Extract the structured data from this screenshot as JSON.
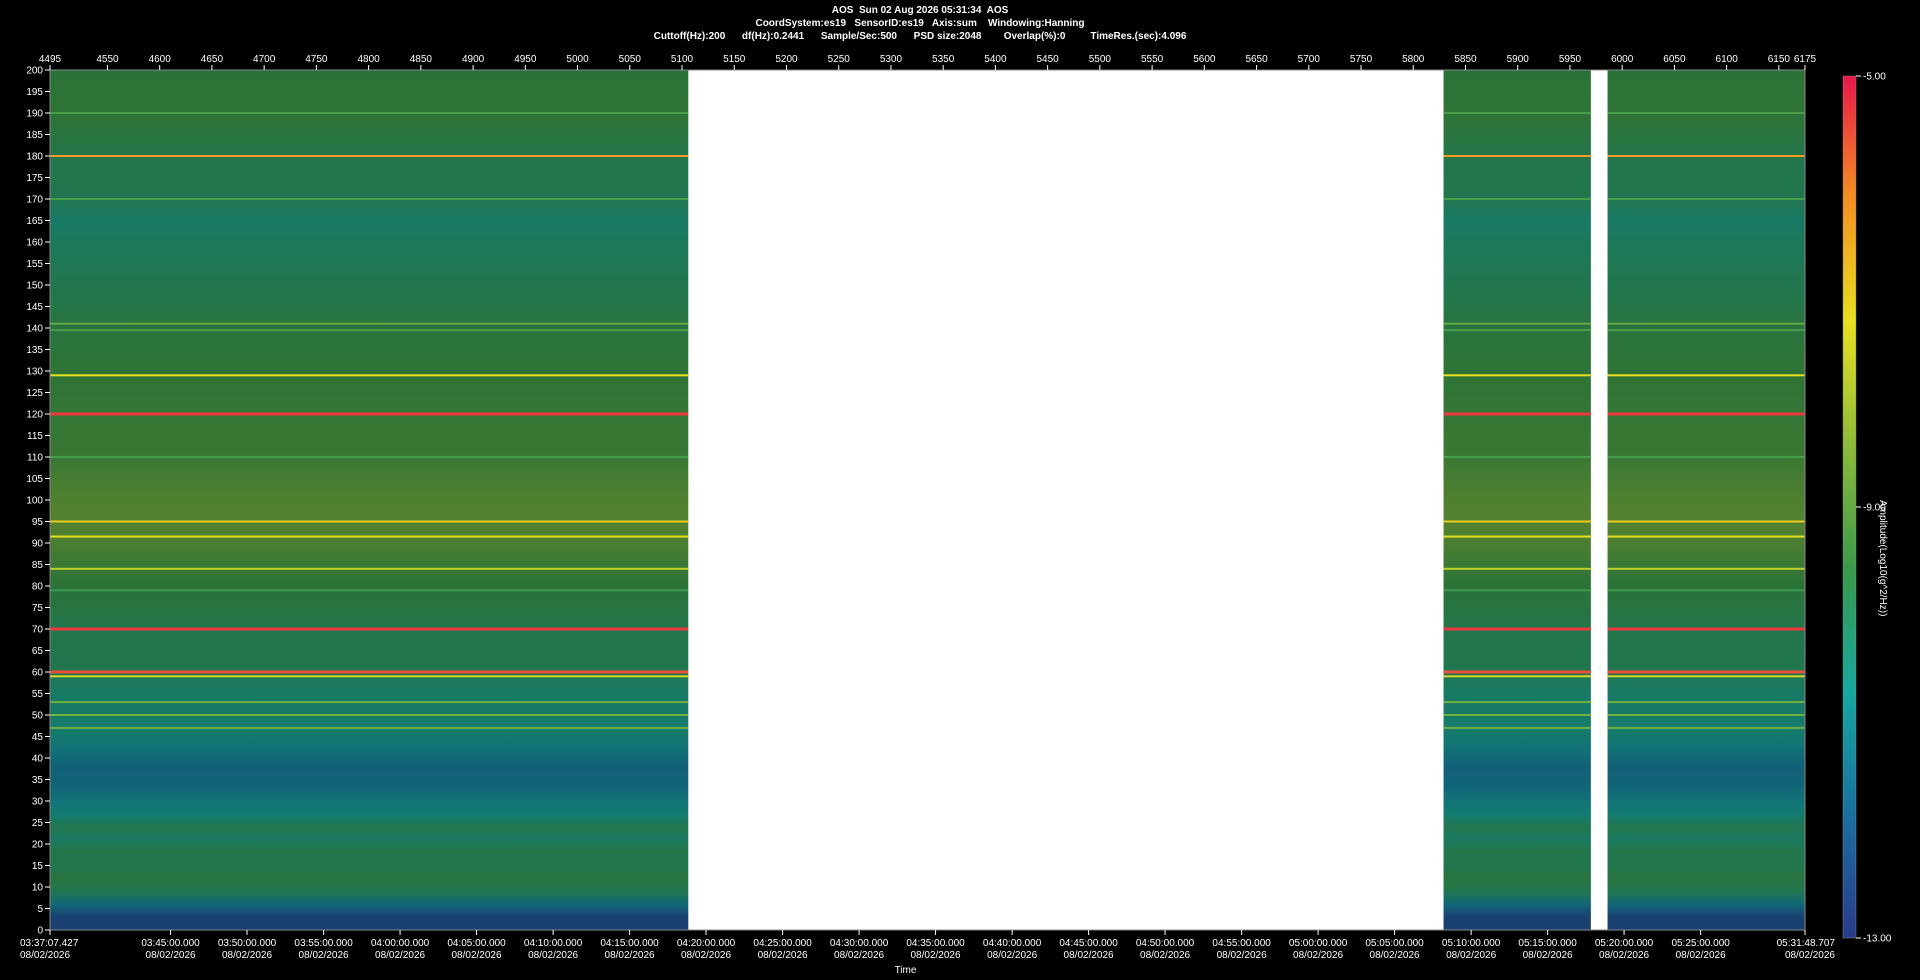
{
  "header": {
    "line1": "AOS  Sun 02 Aug 2026 05:31:34  AOS",
    "line2": "CoordSystem:es19   SensorID:es19   Axis:sum    Windowing:Hanning",
    "line3": "Cuttoff(Hz):200      df(Hz):0.2441      Sample/Sec:500      PSD size:2048        Overlap(%):0         TimeRes.(sec):4.096"
  },
  "colorbar": {
    "title": "Amplitude(Log10(g^2/Hz))",
    "min": -13,
    "max": -5,
    "labels": [
      "-5.00",
      "-9.00",
      "-13.00"
    ],
    "stops": [
      "#2a3a8c",
      "#1a6fa0",
      "#16a8a0",
      "#3a9a4a",
      "#8dba3a",
      "#e8e020",
      "#f59020",
      "#e8184a"
    ]
  },
  "colors": {
    "background": "#000000",
    "gap": "#ffffff",
    "tick": "#ffffff"
  },
  "chart_data": {
    "type": "heatmap",
    "title": "AOS  Sun 02 Aug 2026 05:31:34  AOS",
    "xlabel": "Time",
    "ylabel": "",
    "top_axis_range": [
      4495,
      6175
    ],
    "top_axis_ticks": [
      4495,
      4550,
      4600,
      4650,
      4700,
      4750,
      4800,
      4850,
      4900,
      4950,
      5000,
      5050,
      5100,
      5150,
      5200,
      5250,
      5300,
      5350,
      5400,
      5450,
      5500,
      5550,
      5600,
      5650,
      5700,
      5750,
      5800,
      5850,
      5900,
      5950,
      6000,
      6050,
      6100,
      6150,
      6175
    ],
    "ylim": [
      0,
      200
    ],
    "y_ticks": [
      0,
      5,
      10,
      15,
      20,
      25,
      30,
      35,
      40,
      45,
      50,
      55,
      60,
      65,
      70,
      75,
      80,
      85,
      90,
      95,
      100,
      105,
      110,
      115,
      120,
      125,
      130,
      135,
      140,
      145,
      150,
      155,
      160,
      165,
      170,
      175,
      180,
      185,
      190,
      195,
      200
    ],
    "x_tick_labels": [
      {
        "time": "03:37:07.427",
        "date": "08/02/2026",
        "pos": 4495
      },
      {
        "time": "03:45:00.000",
        "date": "08/02/2026",
        "pos": 4610.4
      },
      {
        "time": "03:50:00.000",
        "date": "08/02/2026",
        "pos": 4683.6
      },
      {
        "time": "03:55:00.000",
        "date": "08/02/2026",
        "pos": 4756.9
      },
      {
        "time": "04:00:00.000",
        "date": "08/02/2026",
        "pos": 4830.1
      },
      {
        "time": "04:05:00.000",
        "date": "08/02/2026",
        "pos": 4903.3
      },
      {
        "time": "04:10:00.000",
        "date": "08/02/2026",
        "pos": 4976.6
      },
      {
        "time": "04:15:00.000",
        "date": "08/02/2026",
        "pos": 5049.8
      },
      {
        "time": "04:20:00.000",
        "date": "08/02/2026",
        "pos": 5123.0
      },
      {
        "time": "04:25:00.000",
        "date": "08/02/2026",
        "pos": 5196.3
      },
      {
        "time": "04:30:00.000",
        "date": "08/02/2026",
        "pos": 5269.5
      },
      {
        "time": "04:35:00.000",
        "date": "08/02/2026",
        "pos": 5342.7
      },
      {
        "time": "04:40:00.000",
        "date": "08/02/2026",
        "pos": 5416.0
      },
      {
        "time": "04:45:00.000",
        "date": "08/02/2026",
        "pos": 5489.2
      },
      {
        "time": "04:50:00.000",
        "date": "08/02/2026",
        "pos": 5562.4
      },
      {
        "time": "04:55:00.000",
        "date": "08/02/2026",
        "pos": 5635.7
      },
      {
        "time": "05:00:00.000",
        "date": "08/02/2026",
        "pos": 5708.9
      },
      {
        "time": "05:05:00.000",
        "date": "08/02/2026",
        "pos": 5782.1
      },
      {
        "time": "05:10:00.000",
        "date": "08/02/2026",
        "pos": 5855.4
      },
      {
        "time": "05:15:00.000",
        "date": "08/02/2026",
        "pos": 5928.6
      },
      {
        "time": "05:20:00.000",
        "date": "08/02/2026",
        "pos": 6001.8
      },
      {
        "time": "05:25:00.000",
        "date": "08/02/2026",
        "pos": 6075.1
      },
      {
        "time": "05:31:48.707",
        "date": "08/02/2026",
        "pos": 6175
      }
    ],
    "data_segments": [
      [
        4495,
        5106
      ],
      [
        5829,
        5970
      ],
      [
        5986,
        6175
      ]
    ],
    "bands": [
      {
        "f": 180,
        "level": -6.3
      },
      {
        "f": 129,
        "level": -7.3
      },
      {
        "f": 120,
        "level": -5.3
      },
      {
        "f": 95,
        "level": -7.0
      },
      {
        "f": 91.5,
        "level": -7.3
      },
      {
        "f": 84,
        "level": -7.8
      },
      {
        "f": 70,
        "level": -5.3
      },
      {
        "f": 60,
        "level": -5.5
      },
      {
        "f": 59,
        "level": -7.5
      },
      {
        "f": 53,
        "level": -8.8
      },
      {
        "f": 50,
        "level": -8.8
      },
      {
        "f": 47,
        "level": -8.8
      },
      {
        "f": 190,
        "level": -9.4
      },
      {
        "f": 170,
        "level": -9.4
      },
      {
        "f": 141,
        "level": -9.0
      },
      {
        "f": 139.5,
        "level": -9.4
      },
      {
        "f": 110,
        "level": -9.4
      },
      {
        "f": 79,
        "level": -9.6
      }
    ],
    "spectrum_profile": [
      {
        "f": 0,
        "level": -12.4
      },
      {
        "f": 3,
        "level": -12.4
      },
      {
        "f": 6,
        "level": -11.3
      },
      {
        "f": 9,
        "level": -10.0
      },
      {
        "f": 12,
        "level": -9.7
      },
      {
        "f": 15,
        "level": -10.0
      },
      {
        "f": 18,
        "level": -9.9
      },
      {
        "f": 21,
        "level": -10.3
      },
      {
        "f": 24,
        "level": -10.0
      },
      {
        "f": 27,
        "level": -10.6
      },
      {
        "f": 30,
        "level": -11.0
      },
      {
        "f": 34,
        "level": -11.4
      },
      {
        "f": 38,
        "level": -11.5
      },
      {
        "f": 42,
        "level": -11.0
      },
      {
        "f": 46,
        "level": -10.5
      },
      {
        "f": 55,
        "level": -10.4
      },
      {
        "f": 60,
        "level": -10.0
      },
      {
        "f": 70,
        "level": -9.9
      },
      {
        "f": 80,
        "level": -9.6
      },
      {
        "f": 88,
        "level": -9.1
      },
      {
        "f": 95,
        "level": -8.8
      },
      {
        "f": 100,
        "level": -8.9
      },
      {
        "f": 110,
        "level": -9.3
      },
      {
        "f": 120,
        "level": -9.4
      },
      {
        "f": 130,
        "level": -9.5
      },
      {
        "f": 140,
        "level": -9.7
      },
      {
        "f": 150,
        "level": -10.0
      },
      {
        "f": 160,
        "level": -10.2
      },
      {
        "f": 165,
        "level": -10.4
      },
      {
        "f": 170,
        "level": -10.0
      },
      {
        "f": 180,
        "level": -9.9
      },
      {
        "f": 190,
        "level": -9.5
      },
      {
        "f": 200,
        "level": -9.6
      }
    ]
  }
}
